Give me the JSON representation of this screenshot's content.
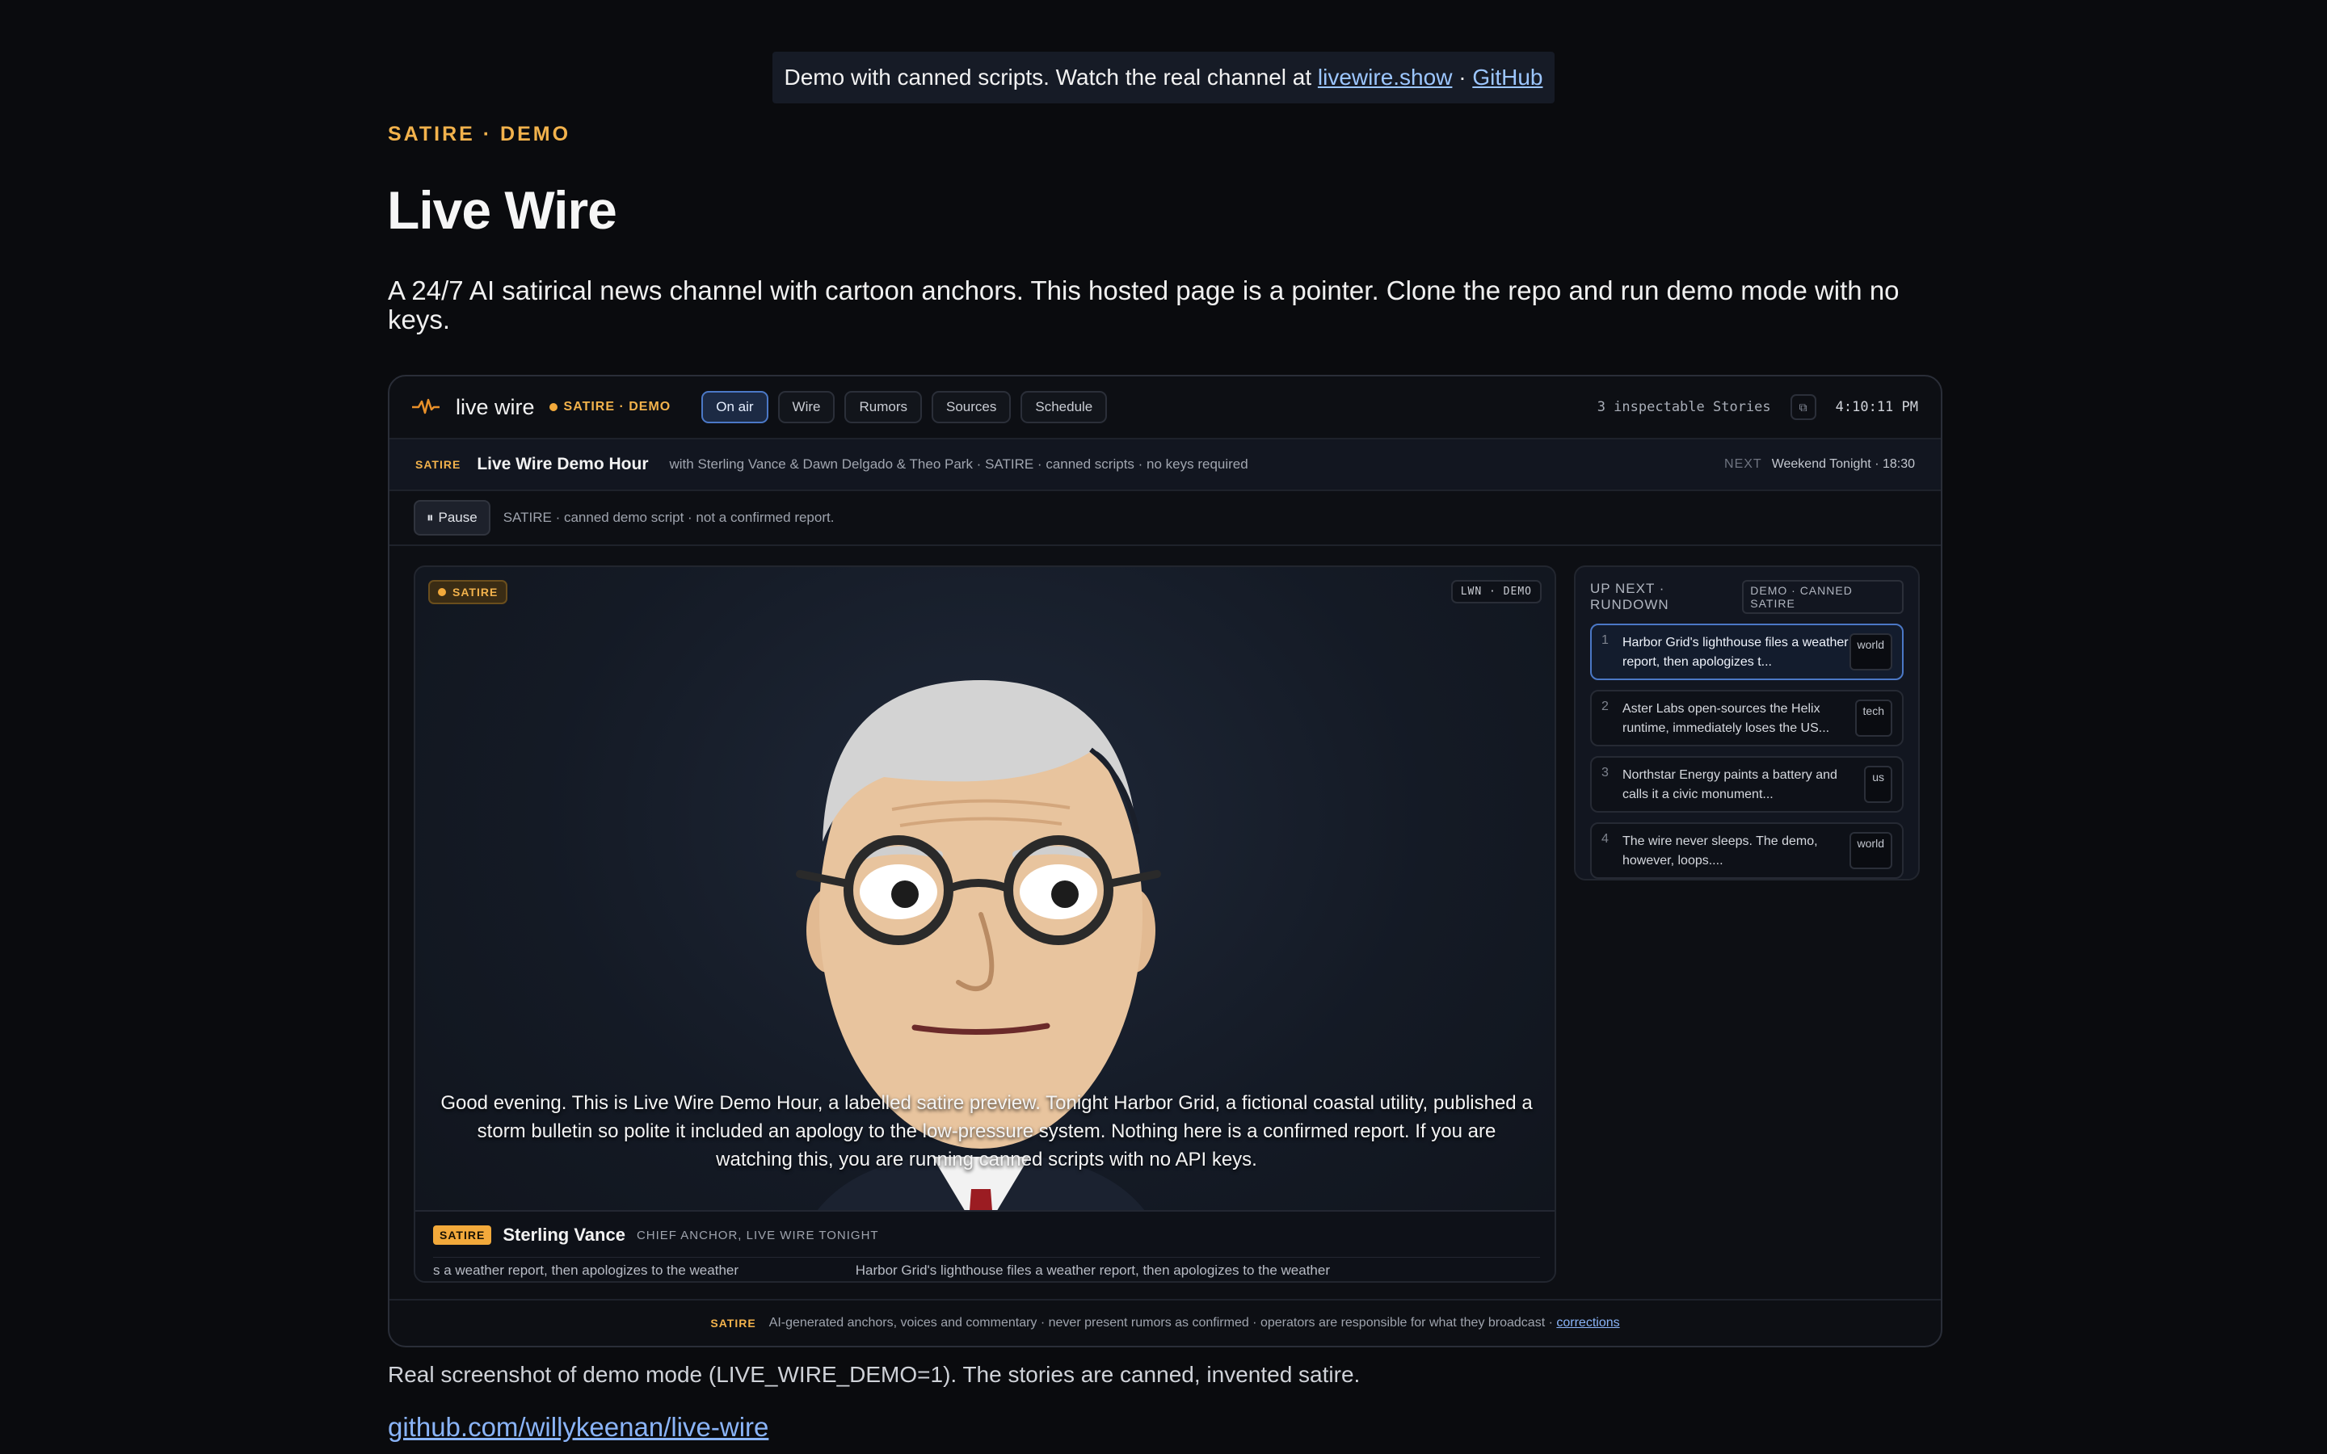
{
  "banner": {
    "text": "Demo with canned scripts. Watch the real channel at",
    "link1": "livewire.show",
    "sep": "·",
    "link2": "GitHub"
  },
  "hero": {
    "eyebrow": "SATIRE · DEMO",
    "title": "Live Wire",
    "lede": "A 24/7 AI satirical news channel with cartoon anchors. This hosted page is a pointer. Clone the repo and run demo mode with no keys."
  },
  "app": {
    "brand": "live wire",
    "brand_badge": "SATIRE · DEMO",
    "tabs": [
      "On air",
      "Wire",
      "Rumors",
      "Sources",
      "Schedule"
    ],
    "active_tab": "On air",
    "inspectable": "3 inspectable Stories",
    "clock": "4:10:11 PM",
    "show": {
      "tag": "SATIRE",
      "title": "Live Wire Demo Hour",
      "meta": "with Sterling Vance & Dawn Delgado & Theo Park · SATIRE · canned scripts · no keys required",
      "next_label": "NEXT",
      "next_value": "Weekend Tonight · 18:30"
    },
    "controls": {
      "pause_label": "Pause",
      "note": "SATIRE · canned demo script · not a confirmed report."
    },
    "stage": {
      "satire_pill": "SATIRE",
      "lwn_pill": "LWN · DEMO",
      "caption": "Good evening. This is Live Wire Demo Hour, a labelled satire preview. Tonight Harbor Grid, a fictional coastal utility, published a storm bulletin so polite it included an apology to the low-pressure system. Nothing here is a confirmed report. If you are watching this, you are running canned scripts with no API keys.",
      "lower_badge": "SATIRE",
      "anchor_name": "Sterling Vance",
      "anchor_role": "CHIEF ANCHOR, LIVE WIRE TONIGHT",
      "ticker": [
        "s a weather report, then apologizes to the weather",
        "Harbor Grid's lighthouse files a weather report, then apologizes to the weather"
      ]
    },
    "rundown": {
      "title": "UP NEXT · RUNDOWN",
      "tag": "DEMO · CANNED SATIRE",
      "items": [
        {
          "num": "1",
          "text": "Harbor Grid's lighthouse files a weather report, then apologizes t...",
          "cat": "world"
        },
        {
          "num": "2",
          "text": "Aster Labs open-sources the Helix runtime, immediately loses the US...",
          "cat": "tech"
        },
        {
          "num": "3",
          "text": "Northstar Energy paints a battery and calls it a civic monument...",
          "cat": "us"
        },
        {
          "num": "4",
          "text": "The wire never sleeps. The demo, however, loops....",
          "cat": "world"
        }
      ]
    },
    "footer": {
      "tag": "SATIRE",
      "text": "AI-generated anchors, voices and commentary · never present rumors as confirmed · operators are responsible for what they broadcast ·",
      "link": "corrections"
    }
  },
  "below": {
    "caption": "Real screenshot of demo mode (LIVE_WIRE_DEMO=1). The stories are canned, invented satire.",
    "repo": "github.com/willykeenan/live-wire"
  },
  "colors": {
    "accent": "#f2b24c",
    "active_blue": "#4b78c6",
    "background": "#0a0b0e",
    "tie": "#9b1c22",
    "skin": "#e8c49e"
  }
}
